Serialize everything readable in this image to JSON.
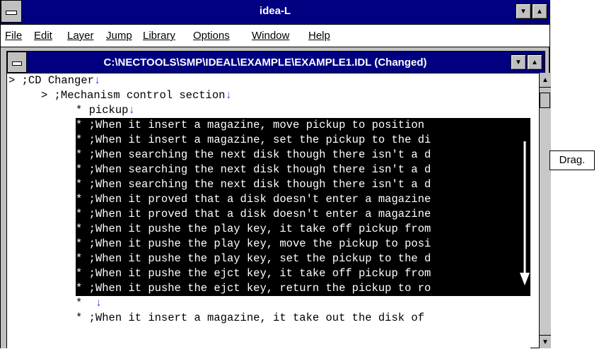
{
  "window": {
    "title": "idea-L"
  },
  "menu": [
    "File",
    "Edit",
    "Layer",
    "Jump",
    "Library",
    "Options",
    "Window",
    "Help"
  ],
  "document": {
    "title": "C:\\NECTOOLS\\SMP\\IDEAL\\EXAMPLE\\EXAMPLE1.IDL (Changed)"
  },
  "lines": [
    {
      "indent": 0,
      "marker": ">",
      "text": ";CD Changer",
      "newline": true,
      "selected": false
    },
    {
      "indent": 1,
      "marker": ">",
      "text": ";Mechanism control section",
      "newline": true,
      "selected": false
    },
    {
      "indent": 2,
      "marker": "*",
      "text": "pickup",
      "newline": true,
      "selected": false
    },
    {
      "indent": 2,
      "marker": "*",
      "text": ";When it insert a magazine, move pickup to position",
      "newline": false,
      "selected": true
    },
    {
      "indent": 2,
      "marker": "*",
      "text": ";When it insert a magazine, set the pickup to the di",
      "newline": false,
      "selected": true
    },
    {
      "indent": 2,
      "marker": "*",
      "text": ";When searching the next disk though there isn't a d",
      "newline": false,
      "selected": true
    },
    {
      "indent": 2,
      "marker": "*",
      "text": ";When searching the next disk though there isn't a d",
      "newline": false,
      "selected": true
    },
    {
      "indent": 2,
      "marker": "*",
      "text": ";When searching the next disk though there isn't a d",
      "newline": false,
      "selected": true
    },
    {
      "indent": 2,
      "marker": "*",
      "text": ";When it proved that a disk doesn't enter a magazine",
      "newline": false,
      "selected": true
    },
    {
      "indent": 2,
      "marker": "*",
      "text": ";When it proved that a disk doesn't enter a magazine",
      "newline": false,
      "selected": true
    },
    {
      "indent": 2,
      "marker": "*",
      "text": ";When it pushe the play key, it take off pickup from",
      "newline": false,
      "selected": true
    },
    {
      "indent": 2,
      "marker": "*",
      "text": ";When it pushe the play key, move the pickup to posi",
      "newline": false,
      "selected": true
    },
    {
      "indent": 2,
      "marker": "*",
      "text": ";When it pushe the play key, set the pickup to the d",
      "newline": false,
      "selected": true
    },
    {
      "indent": 2,
      "marker": "*",
      "text": ";When it pushe the ejct key, it take off pickup from",
      "newline": false,
      "selected": true
    },
    {
      "indent": 2,
      "marker": "*",
      "text": ";When it pushe the ejct key, return the pickup to ro",
      "newline": false,
      "selected": true
    },
    {
      "indent": 2,
      "marker": "*",
      "text": "",
      "newline": true,
      "selected": false
    },
    {
      "indent": 2,
      "marker": "*",
      "text": ";When it insert a magazine, it take out the disk of",
      "newline": false,
      "selected": false
    }
  ],
  "newline_glyph": "↓",
  "callout": {
    "text": "Drag."
  },
  "colors": {
    "title_bar": "#000080",
    "selection": "#000000",
    "newline_mark": "#1a3cff"
  }
}
